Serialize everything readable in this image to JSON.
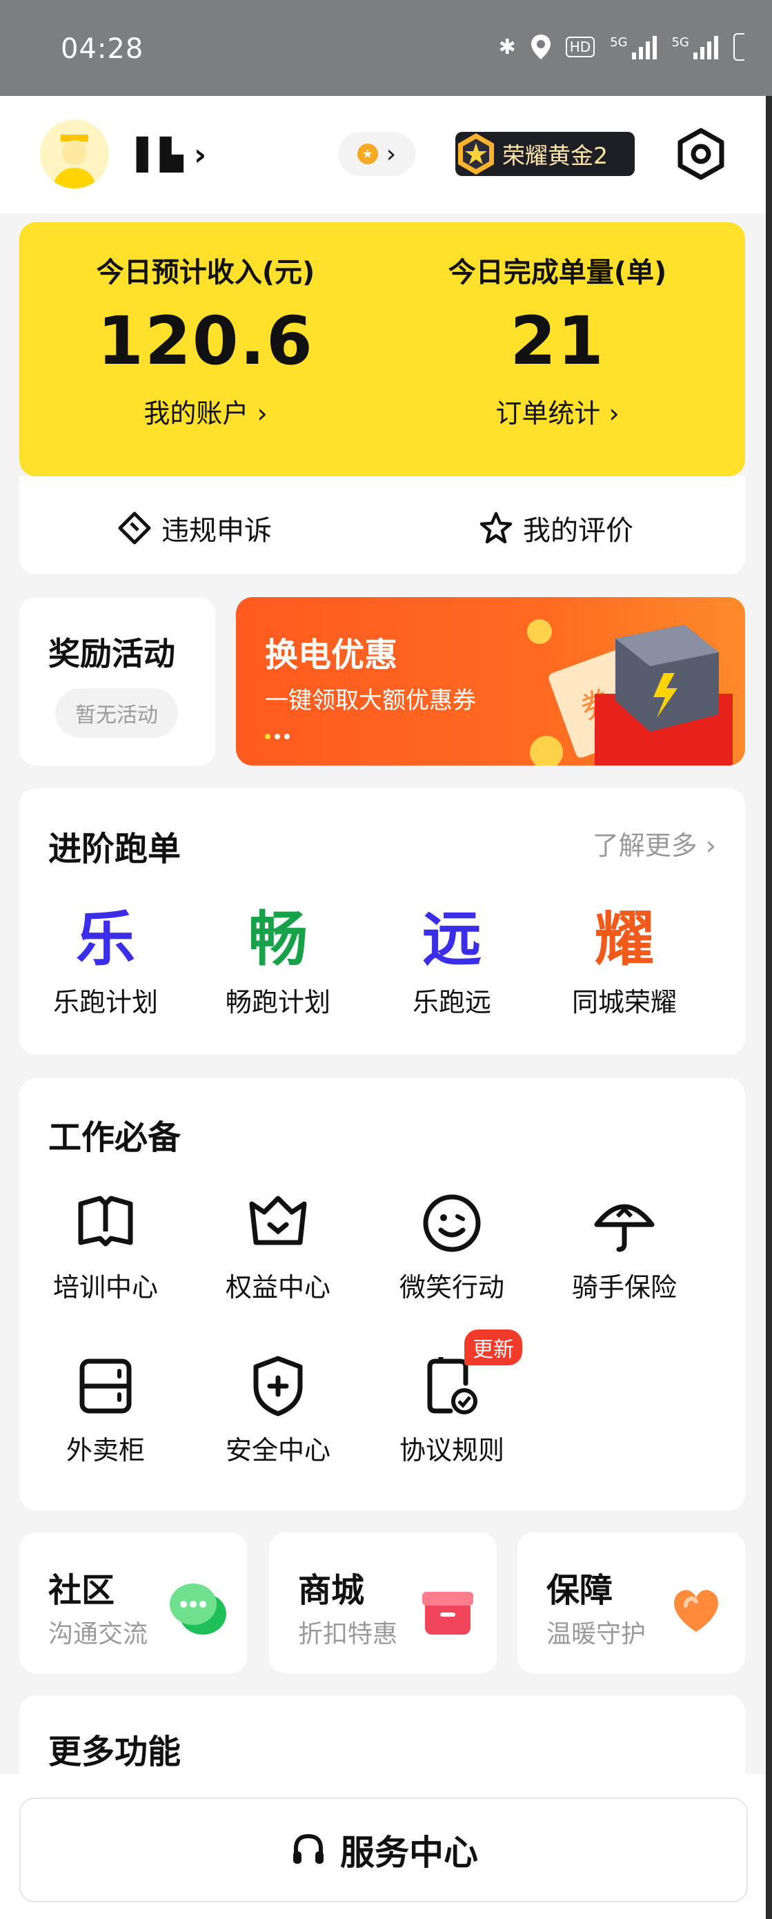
{
  "status_bar": {
    "time": "04:28",
    "hd_badge": "HD",
    "net1": "5G",
    "net2": "5G"
  },
  "header": {
    "username": "▌▙",
    "rank_title": "荣耀黄金2"
  },
  "income_card": {
    "income_label": "今日预计收入(元)",
    "income_value": "120.6",
    "account_link": "我的账户 ›",
    "orders_label": "今日完成单量(单)",
    "orders_value": "21",
    "orders_link": "订单统计 ›"
  },
  "quick_actions": {
    "appeal": "违规申诉",
    "review": "我的评价"
  },
  "reward": {
    "title": "奖励活动",
    "chip": "暂无活动"
  },
  "banner": {
    "title": "换电优惠",
    "subtitle": "一键领取大额优惠券",
    "ticket_text": "券"
  },
  "advanced": {
    "title": "进阶跑单",
    "more": "了解更多 ›",
    "items": [
      {
        "char": "乐",
        "label": "乐跑计划",
        "color": "#3a2ee8"
      },
      {
        "char": "畅",
        "label": "畅跑计划",
        "color": "#17a24a"
      },
      {
        "char": "远",
        "label": "乐跑远",
        "color": "#3a2ee8"
      },
      {
        "char": "耀",
        "label": "同城荣耀",
        "color": "#f25a1a"
      }
    ]
  },
  "essentials": {
    "title": "工作必备",
    "items": [
      {
        "label": "培训中心",
        "icon": "book-icon"
      },
      {
        "label": "权益中心",
        "icon": "crown-icon"
      },
      {
        "label": "微笑行动",
        "icon": "smile-icon"
      },
      {
        "label": "骑手保险",
        "icon": "umbrella-icon"
      },
      {
        "label": "外卖柜",
        "icon": "locker-icon"
      },
      {
        "label": "安全中心",
        "icon": "shield-icon"
      },
      {
        "label": "协议规则",
        "icon": "agreement-icon"
      }
    ],
    "new_tag": "更新"
  },
  "mini_cards": [
    {
      "title": "社区",
      "subtitle": "沟通交流",
      "icon": "chat-icon"
    },
    {
      "title": "商城",
      "subtitle": "折扣特惠",
      "icon": "gift-icon"
    },
    {
      "title": "保障",
      "subtitle": "温暖守护",
      "icon": "heart-icon"
    }
  ],
  "more_features": {
    "title": "更多功能"
  },
  "service": {
    "label": "服务中心"
  }
}
